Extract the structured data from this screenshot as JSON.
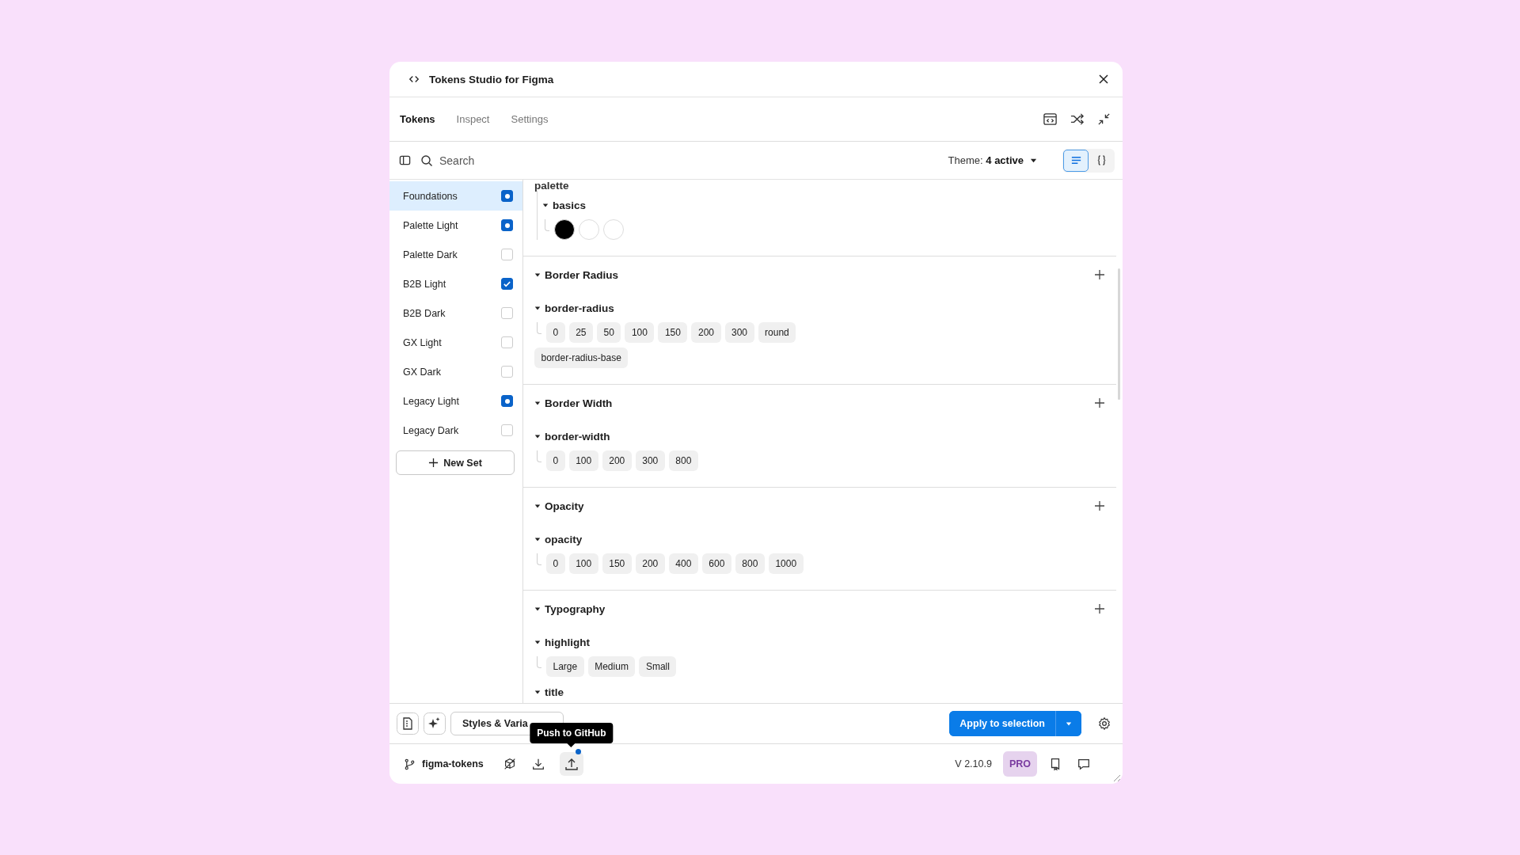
{
  "window": {
    "title": "Tokens Studio for Figma"
  },
  "tabs": [
    {
      "label": "Tokens",
      "selected": true
    },
    {
      "label": "Inspect",
      "selected": false
    },
    {
      "label": "Settings",
      "selected": false
    }
  ],
  "search": {
    "placeholder": "Search"
  },
  "theme": {
    "label": "Theme:",
    "value": "4 active"
  },
  "view_modes": [
    {
      "kind": "list",
      "selected": true
    },
    {
      "kind": "json",
      "selected": false
    }
  ],
  "token_sets": [
    {
      "name": "Foundations",
      "selected": true,
      "kind": "source",
      "checked": true
    },
    {
      "name": "Palette Light",
      "selected": false,
      "kind": "source",
      "checked": true
    },
    {
      "name": "Palette Dark",
      "selected": false,
      "checked": false
    },
    {
      "name": "B2B Light",
      "selected": false,
      "kind": "set",
      "checked": true
    },
    {
      "name": "B2B Dark",
      "selected": false,
      "checked": false
    },
    {
      "name": "GX Light",
      "selected": false,
      "checked": false
    },
    {
      "name": "GX Dark",
      "selected": false,
      "checked": false
    },
    {
      "name": "Legacy Light",
      "selected": false,
      "kind": "source",
      "checked": true
    },
    {
      "name": "Legacy Dark",
      "selected": false,
      "checked": false
    }
  ],
  "new_set_button": "New Set",
  "top_group": {
    "name": "palette",
    "children": [
      {
        "name": "basics",
        "swatches": [
          {
            "color": "#000000"
          },
          {
            "color": "#ffffff"
          },
          {
            "color": "#ffffff"
          }
        ]
      }
    ]
  },
  "sections": [
    {
      "title": "Border Radius",
      "groups": [
        {
          "name": "border-radius",
          "tokens": [
            "0",
            "25",
            "50",
            "100",
            "150",
            "200",
            "300",
            "round",
            "border-radius-base"
          ]
        }
      ]
    },
    {
      "title": "Border Width",
      "groups": [
        {
          "name": "border-width",
          "tokens": [
            "0",
            "100",
            "200",
            "300",
            "800"
          ]
        }
      ]
    },
    {
      "title": "Opacity",
      "groups": [
        {
          "name": "opacity",
          "tokens": [
            "0",
            "100",
            "150",
            "200",
            "400",
            "600",
            "800",
            "1000"
          ]
        }
      ]
    },
    {
      "title": "Typography",
      "groups": [
        {
          "name": "highlight",
          "tokens": [
            "Large",
            "Medium",
            "Small"
          ]
        },
        {
          "name": "title"
        }
      ]
    }
  ],
  "footer": {
    "styles_button": "Styles & Varia",
    "apply_button": "Apply to selection"
  },
  "tooltip": "Push to GitHub",
  "status_bar": {
    "branch": "figma-tokens",
    "push_pending": true,
    "version": "V 2.10.9",
    "plan": "PRO"
  }
}
